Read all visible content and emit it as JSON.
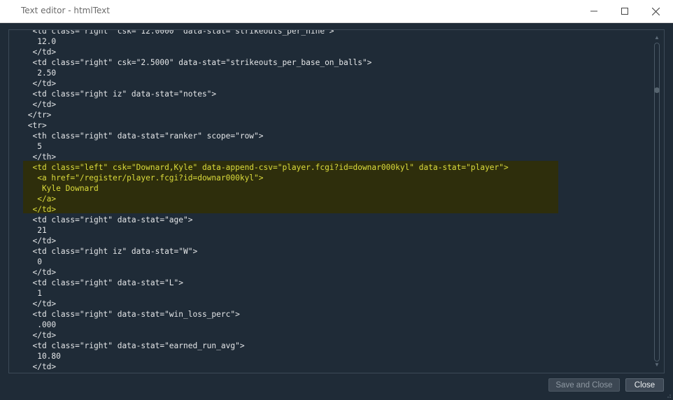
{
  "window": {
    "title": "Text editor - htmlText"
  },
  "editor": {
    "lines": [
      "  <td class=\"right\" csk=\"12.0000\" data-stat=\"strikeouts_per_nine\">",
      "   12.0",
      "  </td>",
      "  <td class=\"right\" csk=\"2.5000\" data-stat=\"strikeouts_per_base_on_balls\">",
      "   2.50",
      "  </td>",
      "  <td class=\"right iz\" data-stat=\"notes\">",
      "  </td>",
      " </tr>",
      " <tr>",
      "  <th class=\"right\" data-stat=\"ranker\" scope=\"row\">",
      "   5",
      "  </th>",
      "  <td class=\"left\" csk=\"Downard,Kyle\" data-append-csv=\"player.fcgi?id=downar000kyl\" data-stat=\"player\">",
      "   <a href=\"/register/player.fcgi?id=downar000kyl\">",
      "    Kyle Downard",
      "   </a>",
      "  </td>",
      "  <td class=\"right\" data-stat=\"age\">",
      "   21",
      "  </td>",
      "  <td class=\"right iz\" data-stat=\"W\">",
      "   0",
      "  </td>",
      "  <td class=\"right\" data-stat=\"L\">",
      "   1",
      "  </td>",
      "  <td class=\"right\" data-stat=\"win_loss_perc\">",
      "   .000",
      "  </td>",
      "  <td class=\"right\" data-stat=\"earned_run_avg\">",
      "   10.80",
      "  </td>"
    ],
    "highlighted_lines": [
      13,
      14,
      15,
      16,
      17
    ],
    "highlight_color": "#2e2e0c",
    "highlight_text_color": "#dcdc3c"
  },
  "buttons": {
    "save_and_close": "Save and Close",
    "close": "Close"
  },
  "icons": {
    "minimize": "minimize-icon",
    "maximize": "maximize-icon",
    "close": "close-icon"
  }
}
